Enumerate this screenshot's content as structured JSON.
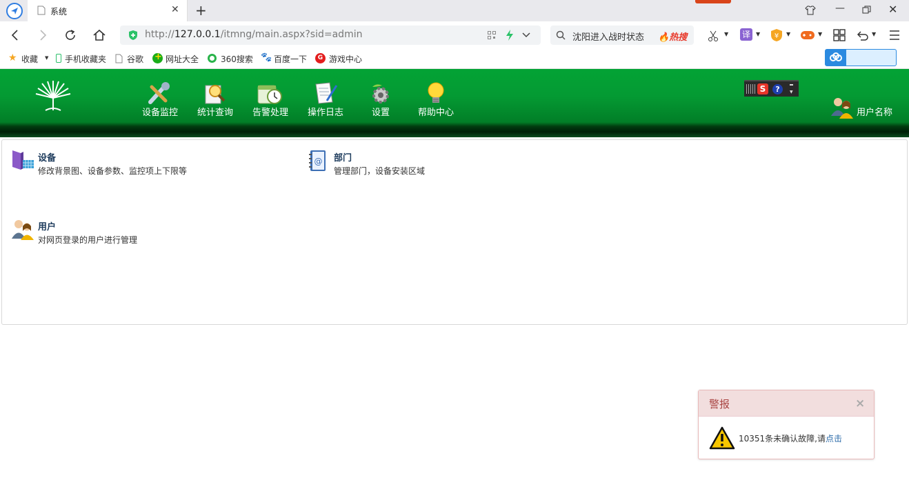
{
  "browser": {
    "tab_title": "系统",
    "url_prefix": "http://",
    "url_host": "127.0.0.1",
    "url_path": "/itmng/main.aspx?sid=admin",
    "search_text": "沈阳进入战时状态",
    "search_hot": "热搜",
    "translate_label": "译"
  },
  "bookmarks": [
    "收藏",
    "手机收藏夹",
    "谷歌",
    "网址大全",
    "360搜索",
    "百度一下",
    "游戏中心"
  ],
  "nav": {
    "items": [
      "设备监控",
      "统计查询",
      "告警处理",
      "操作日志",
      "设置",
      "帮助中心"
    ],
    "user_name": "用户名称"
  },
  "panel": {
    "items": [
      {
        "title": "设备",
        "desc": "修改背景图、设备参数、监控项上下限等"
      },
      {
        "title": "部门",
        "desc": "管理部门，设备安装区域"
      },
      {
        "title": "用户",
        "desc": "对网页登录的用户进行管理"
      }
    ]
  },
  "alert": {
    "title": "警报",
    "message": "10351条未确认故障,请",
    "link": "点击",
    "close": "×"
  },
  "colors": {
    "header_green": "#049a33",
    "alert_head_bg": "#f2dede",
    "alert_title": "#a94442",
    "link_blue": "#2a6aa8"
  }
}
